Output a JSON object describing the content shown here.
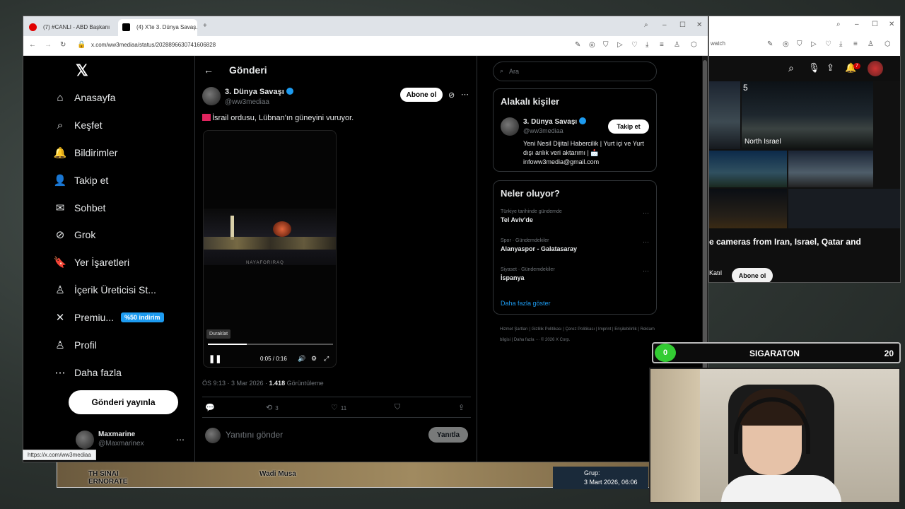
{
  "browser1": {
    "tabs": [
      {
        "label": "(7) #CANLI - ABD Başkanı"
      },
      {
        "label": "(4) X'te 3. Dünya Savaş..."
      }
    ],
    "url": "x.com/ww3mediaa/status/2028896630741606828",
    "status_link": "https://x.com/ww3mediaa"
  },
  "nav": {
    "items": [
      {
        "label": "Anasayfa",
        "icon": "home-icon",
        "glyph": "⌂"
      },
      {
        "label": "Keşfet",
        "icon": "search-icon",
        "glyph": "⌕"
      },
      {
        "label": "Bildirimler",
        "icon": "bell-icon",
        "glyph": "🔔"
      },
      {
        "label": "Takip et",
        "icon": "add-person-icon",
        "glyph": "👤"
      },
      {
        "label": "Sohbet",
        "icon": "mail-icon",
        "glyph": "✉"
      },
      {
        "label": "Grok",
        "icon": "grok-icon",
        "glyph": "⊘"
      },
      {
        "label": "Yer İşaretleri",
        "icon": "bookmark-icon",
        "glyph": "🔖"
      },
      {
        "label": "İçerik Üreticisi St...",
        "icon": "creator-icon",
        "glyph": "♙"
      },
      {
        "label": "Premiu...",
        "icon": "x-premium-icon",
        "glyph": "✕"
      },
      {
        "label": "Profil",
        "icon": "profile-icon",
        "glyph": "♙"
      },
      {
        "label": "Daha fazla",
        "icon": "more-icon",
        "glyph": "⋯"
      }
    ],
    "premium_badge": "%50 indirim",
    "post_button": "Gönderi yayınla",
    "me_name": "Maxmarine",
    "me_handle": "@Maxmarinex"
  },
  "post": {
    "header": "Gönderi",
    "author_name": "3. Dünya Savaşı",
    "author_handle": "@ww3mediaa",
    "follow_label": "Abone ol",
    "text": "İsrail ordusu, Lübnan'ın güneyini vuruyor.",
    "video": {
      "watermark": "NAYAFORIRAQ",
      "tooltip": "Duraklat",
      "time": "0:05 / 0:16",
      "progress": 0.31
    },
    "time": "ÖS 9:13 · 3 Mar 2026 · ",
    "views": "1.418",
    "views_label": " Görüntüleme",
    "retweets": "3",
    "likes": "11",
    "reply_placeholder": "Yanıtını gönder",
    "reply_button": "Yanıtla"
  },
  "sidebar": {
    "search_placeholder": "Ara",
    "related_title": "Alakalı kişiler",
    "related_name": "3. Dünya Savaşı",
    "related_handle": "@ww3mediaa",
    "related_follow": "Takip et",
    "related_bio": "Yeni Nesil Dijital Habercilik | Yurt içi ve Yurt dışı anlık veri aktarımı | 📩 infoww3media@gmail.com",
    "trends_title": "Neler oluyor?",
    "trends": [
      {
        "category": "Türkiye tarihinde gündemde",
        "name": "Tel Aviv'de"
      },
      {
        "category": "Spor · Gündemdekiler",
        "name": "Alanyaspor - Galatasaray"
      },
      {
        "category": "Siyaset · Gündemdekiler",
        "name": "İspanya"
      }
    ],
    "show_more": "Daha fazla göster",
    "footer": "Hizmet Şartları | Gizlilik Politikası | Çerez Politikası | Imprint | Erişilebilirlik | Reklam bilgisi | Daha fazla ··· © 2026 X Corp."
  },
  "browser2": {
    "url": "watch",
    "notif_count": "7",
    "cam_labels": [
      "North Israel",
      "5"
    ],
    "title": "e cameras from Iran, Israel, Qatar and",
    "join": "Katıl",
    "subscribe": "Abone ol"
  },
  "overlay": {
    "counter_left": "0",
    "label": "SIGARATON",
    "counter_right": "20"
  },
  "map": {
    "labels": [
      "TH SINAI",
      "ERNORATE",
      "Wadi Musa"
    ],
    "group_label": "Grup:",
    "group_date": "3 Mart 2026, 06:06"
  }
}
